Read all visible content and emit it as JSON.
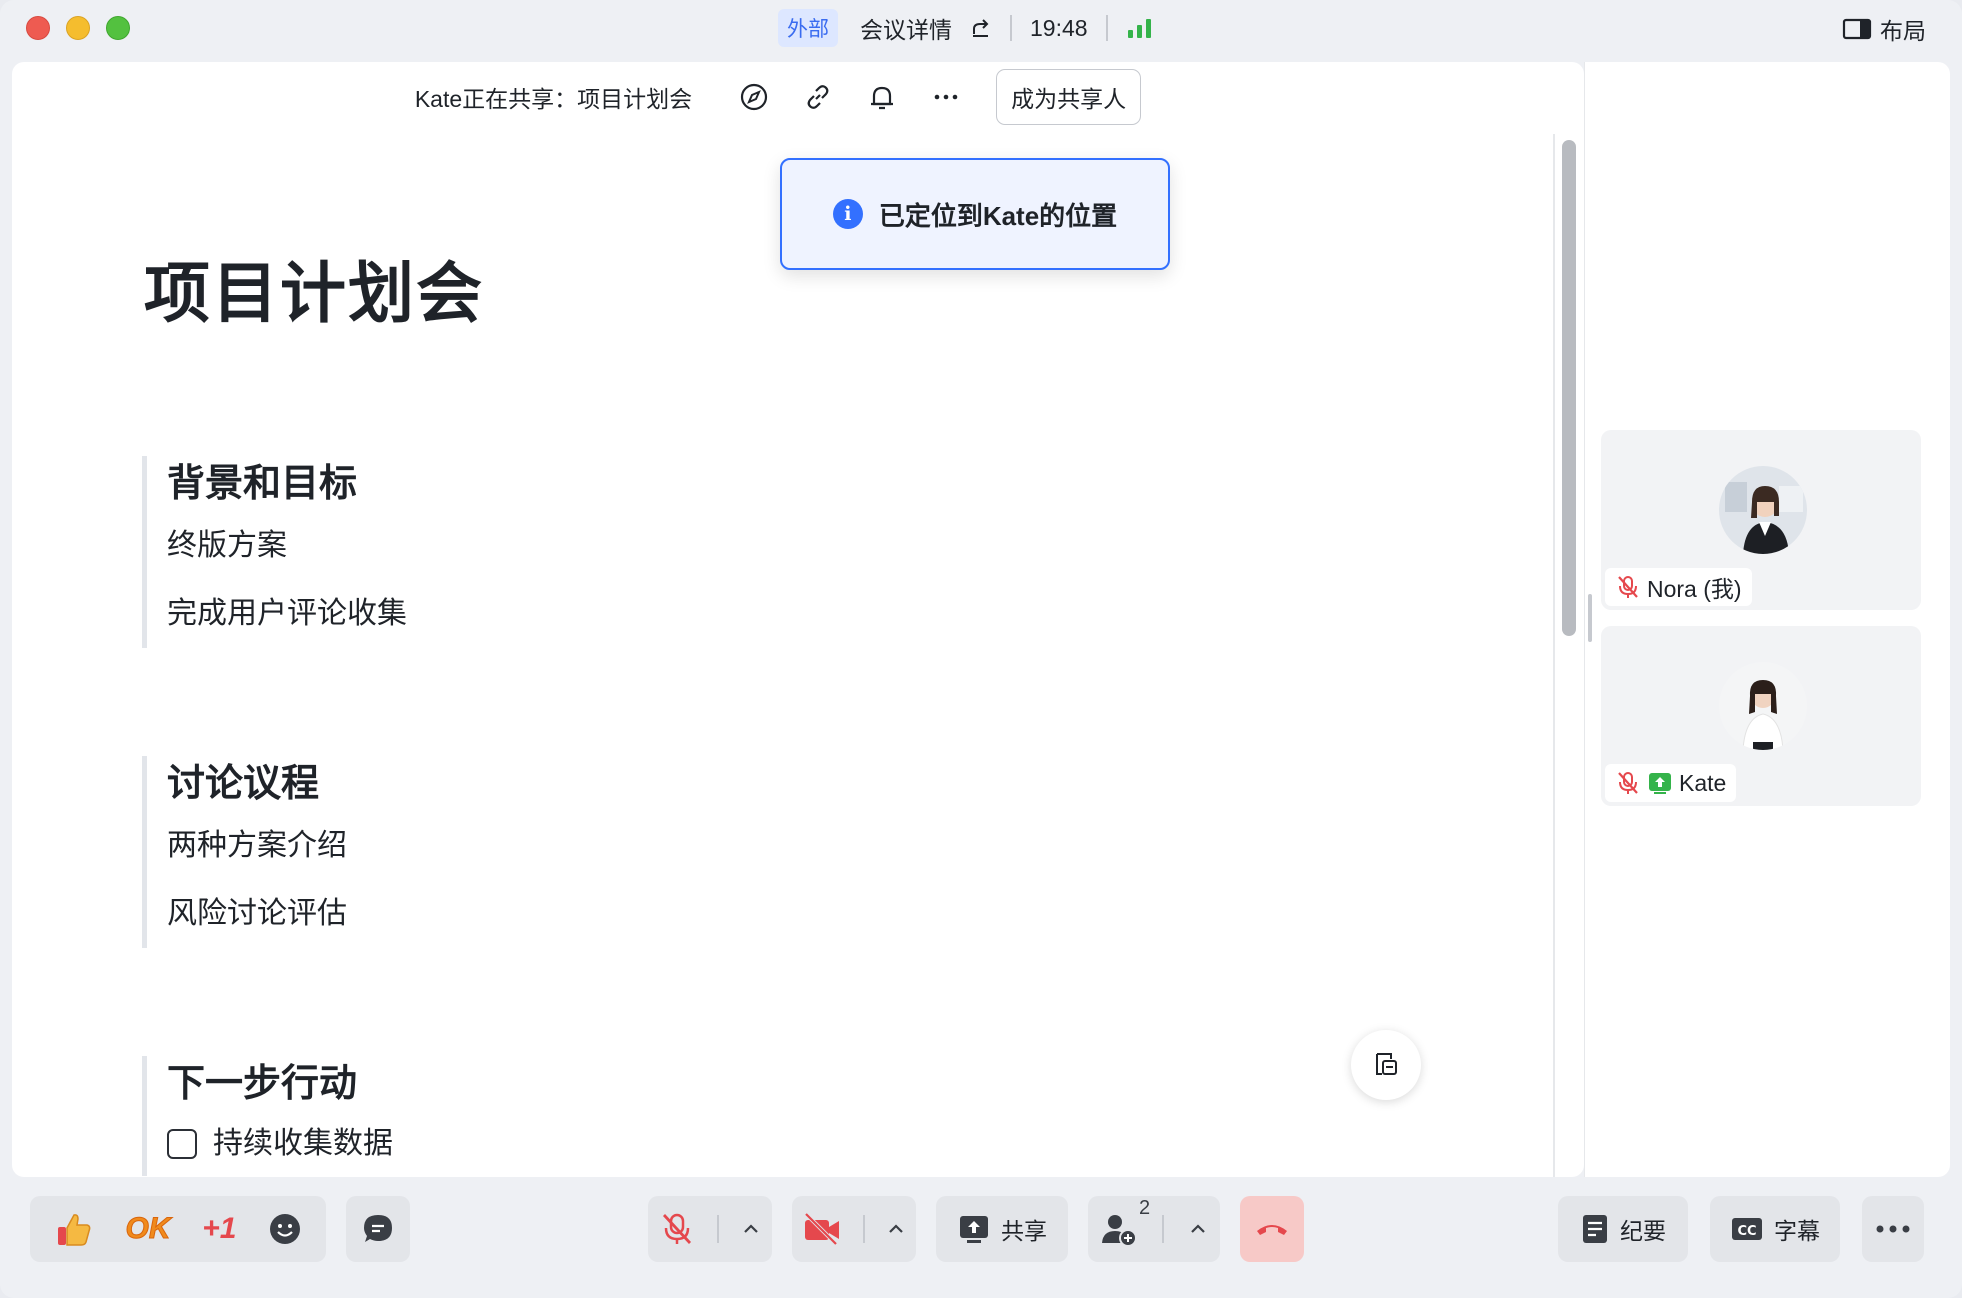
{
  "titlebar": {
    "tag": "外部",
    "meeting_details": "会议详情",
    "time": "19:48",
    "layout_label": "布局"
  },
  "share_bar": {
    "title": "Kate正在共享：项目计划会",
    "become_presenter": "成为共享人"
  },
  "toast": {
    "icon": "i",
    "text": "已定位到Kate的位置"
  },
  "document": {
    "title": "项目计划会",
    "sections": [
      {
        "heading": "背景和目标",
        "items": [
          "终版方案",
          "完成用户评论收集"
        ]
      },
      {
        "heading": "讨论议程",
        "items": [
          "两种方案介绍",
          "风险讨论评估"
        ]
      },
      {
        "heading": "下一步行动",
        "checklist": [
          "持续收集数据"
        ]
      }
    ]
  },
  "participants": [
    {
      "name": "Nora (我)",
      "muted": true,
      "sharing": false
    },
    {
      "name": "Kate",
      "muted": true,
      "sharing": true
    }
  ],
  "toolbar": {
    "reaction_ok": "OK",
    "reaction_plus_one": "+1",
    "share_label": "共享",
    "participants_count": "2",
    "minutes_label": "纪要",
    "captions_label": "字幕"
  },
  "colors": {
    "accent": "#3370ff",
    "mute_red": "#e5484d",
    "end_call_bg": "#f7c9c7",
    "sharing_green": "#34b34a"
  }
}
